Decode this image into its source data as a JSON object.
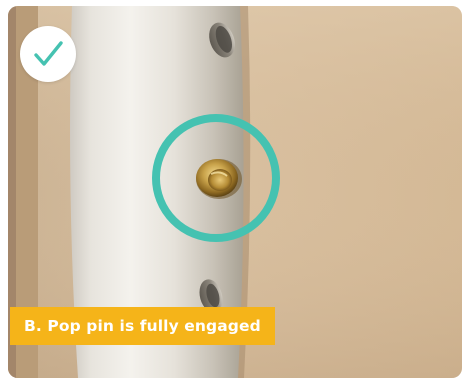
{
  "photo": {
    "subject": "Photo of a white metal tube with a brass pop pin inside one of its holes"
  },
  "badge": {
    "icon": "check-icon",
    "color": "#45c2b1"
  },
  "highlight": {
    "icon": "highlight-ring",
    "color": "#45c2b1"
  },
  "caption": {
    "text": "B. Pop pin is fully engaged",
    "background": "#f5b419"
  }
}
